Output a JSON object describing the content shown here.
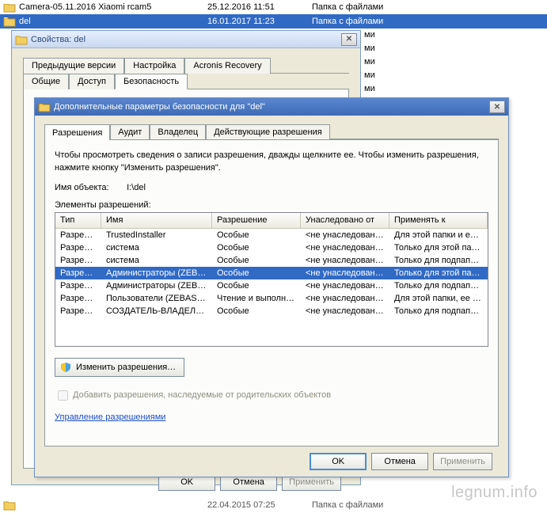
{
  "background": {
    "rows": [
      {
        "name": "Camera-05.11.2016 Xiaomi rcam5",
        "date": "25.12.2016 11:51",
        "type": "Папка с файлами",
        "selected": false
      },
      {
        "name": "del",
        "date": "16.01.2017 11:23",
        "type": "Папка с файлами",
        "selected": true
      }
    ],
    "right_slivers": [
      "ми",
      "ми",
      "ми",
      "ми",
      "ми",
      "ми"
    ],
    "bottom": {
      "name": "",
      "date": "22.04.2015 07:25",
      "type": "Папка с файлами"
    }
  },
  "props_dialog": {
    "title": "Свойства: del",
    "tabs_row1": [
      "Предыдущие версии",
      "Настройка",
      "Acronis Recovery"
    ],
    "tabs_row2": [
      "Общие",
      "Доступ",
      "Безопасность"
    ],
    "active_tab": "Безопасность",
    "buttons": {
      "ok": "OK",
      "cancel": "Отмена",
      "apply": "Применить"
    }
  },
  "adv_dialog": {
    "title": "Дополнительные параметры безопасности для \"del\"",
    "tabs": [
      "Разрешения",
      "Аудит",
      "Владелец",
      "Действующие разрешения"
    ],
    "active_tab": "Разрешения",
    "info_text": "Чтобы просмотреть сведения о записи разрешения, дважды щелкните ее. Чтобы изменить разрешения, нажмите кнопку \"Изменить разрешения\".",
    "object_label": "Имя объекта:",
    "object_value": "I:\\del",
    "elements_label": "Элементы разрешений:",
    "columns": {
      "type": "Тип",
      "name": "Имя",
      "perm": "Разрешение",
      "inherited": "Унаследовано от",
      "apply": "Применять к"
    },
    "rows": [
      {
        "type": "Разреш…",
        "name": "TrustedInstaller",
        "perm": "Особые",
        "inherited": "<не унаследовано>",
        "apply": "Для этой папки и ее по…",
        "selected": false
      },
      {
        "type": "Разреш…",
        "name": "система",
        "perm": "Особые",
        "inherited": "<не унаследовано>",
        "apply": "Только для этой папки",
        "selected": false
      },
      {
        "type": "Разреш…",
        "name": "система",
        "perm": "Особые",
        "inherited": "<не унаследовано>",
        "apply": "Только для подпапок и …",
        "selected": false
      },
      {
        "type": "Разреш…",
        "name": "Администраторы (ZEBA…",
        "perm": "Особые",
        "inherited": "<не унаследовано>",
        "apply": "Только для этой папки",
        "selected": true
      },
      {
        "type": "Разреш…",
        "name": "Администраторы (ZEBA…",
        "perm": "Особые",
        "inherited": "<не унаследовано>",
        "apply": "Только для подпапок и …",
        "selected": false
      },
      {
        "type": "Разреш…",
        "name": "Пользователи (ZEBAS-…",
        "perm": "Чтение и выполне…",
        "inherited": "<не унаследовано>",
        "apply": "Для этой папки, ее под…",
        "selected": false
      },
      {
        "type": "Разреш…",
        "name": "СОЗДАТЕЛЬ-ВЛАДЕЛЕЦ",
        "perm": "Особые",
        "inherited": "<не унаследовано>",
        "apply": "Только для подпапок и …",
        "selected": false
      }
    ],
    "change_btn": "Изменить разрешения…",
    "checkbox_label": "Добавить разрешения, наследуемые от родительских объектов",
    "link_text": "Управление разрешениями",
    "buttons": {
      "ok": "OK",
      "cancel": "Отмена",
      "apply": "Применить"
    }
  },
  "watermark": "legnum.info"
}
